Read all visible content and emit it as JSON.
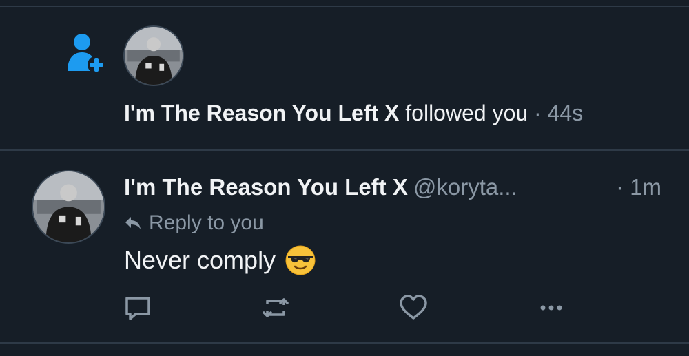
{
  "colors": {
    "background": "#161e27",
    "accent": "#1d9bf0",
    "muted": "#8b98a5",
    "divider": "#2e3a47"
  },
  "notification": {
    "icon": "follow-user-plus-icon",
    "user_name": "I'm The Reason You Left X",
    "action": "followed you",
    "separator": "·",
    "time": "44s"
  },
  "reply": {
    "user_name": "I'm The Reason You Left X",
    "handle": "@koryta...",
    "separator": "·",
    "time": "1m",
    "reply_label": "Reply to you",
    "text": "Never comply",
    "emoji": "smiling-face-with-sunglasses",
    "actions": [
      "reply-icon",
      "retweet-icon",
      "like-icon",
      "more-icon"
    ]
  }
}
